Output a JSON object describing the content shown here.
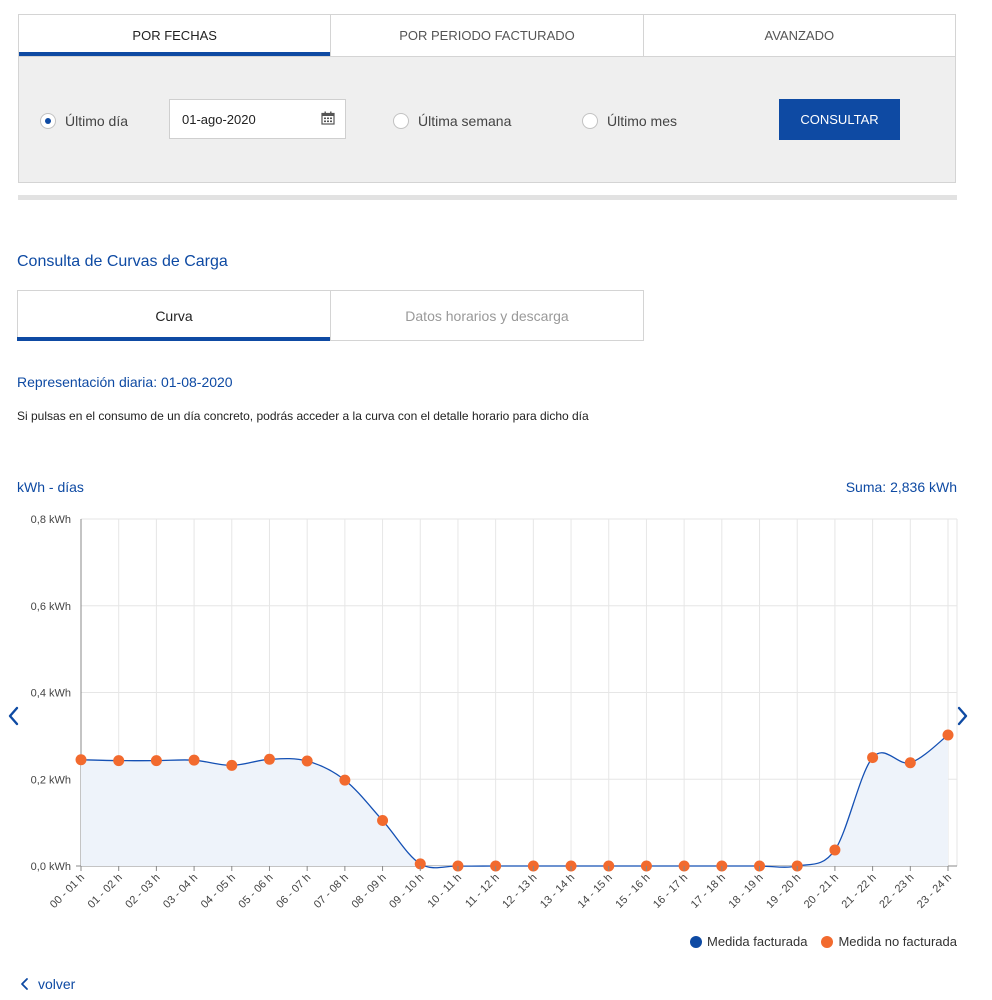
{
  "top_tabs": [
    {
      "label": "POR FECHAS",
      "active": true
    },
    {
      "label": "POR PERIODO FACTURADO",
      "active": false
    },
    {
      "label": "AVANZADO",
      "active": false
    }
  ],
  "filters": {
    "radio_last_day": "Último día",
    "date_value": "01-ago-2020",
    "radio_last_week": "Última semana",
    "radio_last_month": "Último mes",
    "selected": "Último día",
    "consult_button": "CONSULTAR"
  },
  "section_title": "Consulta de Curvas de Carga",
  "sub_tabs": [
    {
      "label": "Curva",
      "active": true
    },
    {
      "label": "Datos horarios y descarga",
      "active": false
    }
  ],
  "representation_label": "Representación diaria: 01-08-2020",
  "info_text": "Si pulsas en el consumo de un día concreto, podrás acceder a la curva con el detalle horario para dicho día",
  "y_unit_label": "kWh - días",
  "sum_label": "Suma: 2,836 kWh",
  "colors": {
    "accent": "#0e4aa3",
    "line": "#1450b4",
    "area_fill": "#eef3fa",
    "billed": "#0e4aa3",
    "not_billed": "#f26a2e"
  },
  "chart_data": {
    "type": "line",
    "categories": [
      "00 - 01 h",
      "01 - 02 h",
      "02 - 03 h",
      "03 - 04 h",
      "04 - 05 h",
      "05 - 06 h",
      "06 - 07 h",
      "07 - 08 h",
      "08 - 09 h",
      "09 - 10 h",
      "10 - 11 h",
      "11 - 12 h",
      "12 - 13 h",
      "13 - 14 h",
      "14 - 15 h",
      "15 - 16 h",
      "16 - 17 h",
      "17 - 18 h",
      "18 - 19 h",
      "19 - 20 h",
      "20 - 21 h",
      "21 - 22 h",
      "22 - 23 h",
      "23 - 24 h"
    ],
    "series": [
      {
        "name": "Medida no facturada",
        "values": [
          0.245,
          0.243,
          0.243,
          0.244,
          0.232,
          0.246,
          0.242,
          0.198,
          0.105,
          0.005,
          0.0,
          0.0,
          0.0,
          0.0,
          0.0,
          0.0,
          0.0,
          0.0,
          0.0,
          0.0,
          0.037,
          0.25,
          0.238,
          0.302
        ]
      }
    ],
    "y_ticks": [
      "0,0 kWh",
      "0,2 kWh",
      "0,4 kWh",
      "0,6 kWh",
      "0,8 kWh"
    ],
    "y_tick_values": [
      0,
      0.2,
      0.4,
      0.6,
      0.8
    ],
    "ylim": [
      0,
      0.8
    ],
    "grid": true,
    "legend": [
      {
        "label": "Medida facturada",
        "color": "#0e4aa3"
      },
      {
        "label": "Medida no facturada",
        "color": "#f26a2e"
      }
    ],
    "legend_position": "bottom-right"
  },
  "back_label": "volver"
}
